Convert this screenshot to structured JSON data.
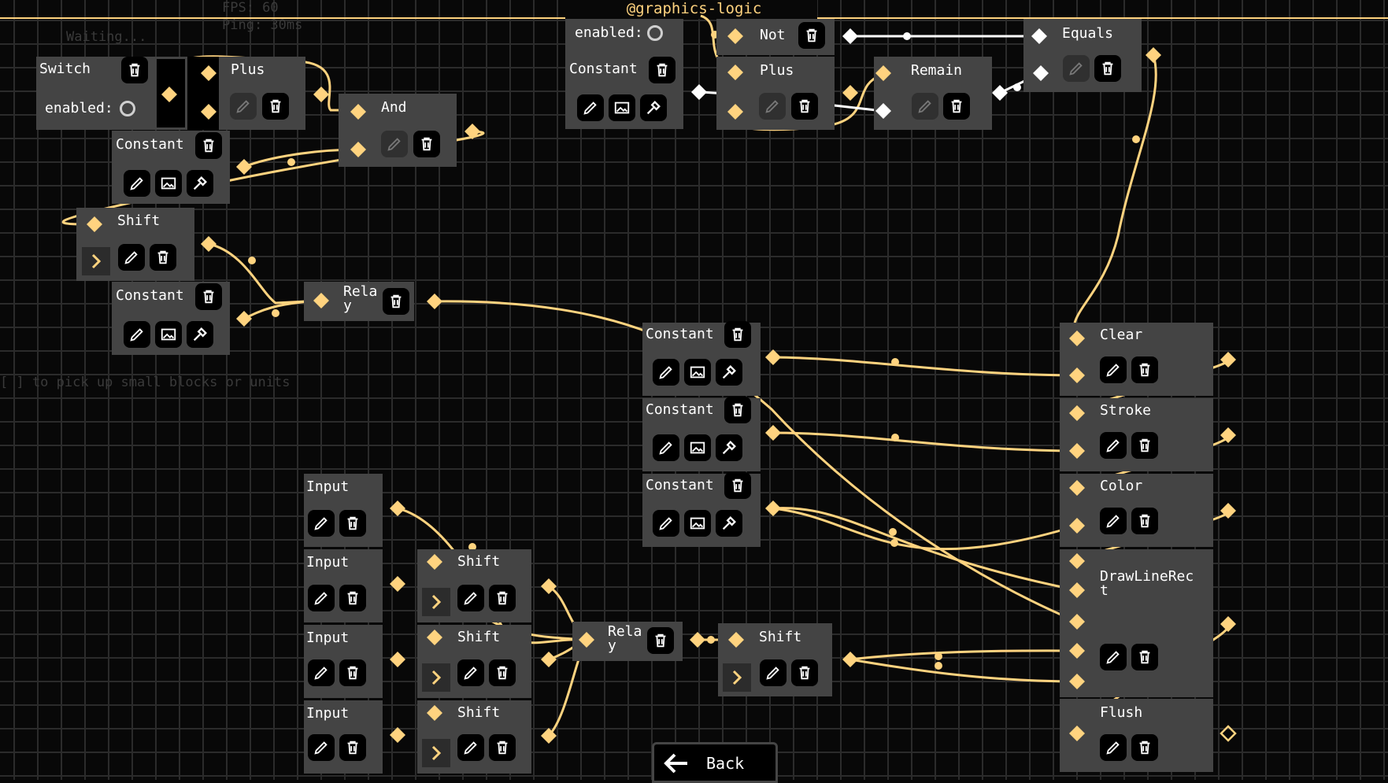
{
  "hud": {
    "fps": "FPS: 60",
    "ping": "Ping: 30ms",
    "status": "Waiting...",
    "tip": "[  ] to pick up small blocks or units"
  },
  "header": {
    "title": "@graphics-logic"
  },
  "back": {
    "label": "Back"
  },
  "colors": {
    "accent": "#ffd37f",
    "block": "#444444",
    "wire": "#ffd37f",
    "white_wire": "#ffffff"
  },
  "nodes": {
    "switch": {
      "title": "Switch",
      "enabled_label": "enabled:"
    },
    "plus1": {
      "title": "Plus"
    },
    "and": {
      "title": "And"
    },
    "constant1": {
      "title": "Constant"
    },
    "shift1": {
      "title": "Shift"
    },
    "constant2": {
      "title": "Constant"
    },
    "relay1": {
      "title": "Rela\ny"
    },
    "enabled_top": {
      "label": "enabled:"
    },
    "not": {
      "title": "Not"
    },
    "constant_top": {
      "title": "Constant"
    },
    "plus2": {
      "title": "Plus"
    },
    "remain": {
      "title": "Remain"
    },
    "equals": {
      "title": "Equals"
    },
    "constant_a": {
      "title": "Constant"
    },
    "constant_b": {
      "title": "Constant"
    },
    "constant_c": {
      "title": "Constant"
    },
    "clear": {
      "title": "Clear"
    },
    "stroke": {
      "title": "Stroke"
    },
    "color": {
      "title": "Color"
    },
    "drawlinerect": {
      "title": "DrawLineRec\nt"
    },
    "flush": {
      "title": "Flush"
    },
    "input1": {
      "title": "Input"
    },
    "input2": {
      "title": "Input"
    },
    "input3": {
      "title": "Input"
    },
    "input4": {
      "title": "Input"
    },
    "shift2": {
      "title": "Shift"
    },
    "shift3": {
      "title": "Shift"
    },
    "shift4": {
      "title": "Shift"
    },
    "relay2": {
      "title": "Rela\ny"
    },
    "shift5": {
      "title": "Shift"
    }
  },
  "icons": [
    "trash-icon",
    "pencil-icon",
    "image-icon",
    "eyedropper-icon",
    "chevron-right-icon",
    "arrow-left-icon"
  ]
}
